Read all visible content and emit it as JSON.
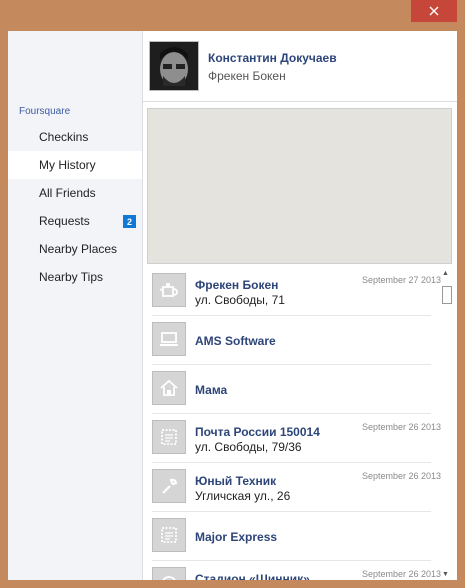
{
  "window": {
    "close_icon": "close-icon"
  },
  "sidebar": {
    "title": "Foursquare",
    "items": [
      {
        "label": "Checkins",
        "selected": false
      },
      {
        "label": "My History",
        "selected": true
      },
      {
        "label": "All Friends",
        "selected": false
      },
      {
        "label": "Requests",
        "selected": false,
        "badge": "2"
      },
      {
        "label": "Nearby Places",
        "selected": false
      },
      {
        "label": "Nearby Tips",
        "selected": false
      }
    ]
  },
  "profile": {
    "name": "Константин Докучаев",
    "location": "Фрекен Бокен"
  },
  "history": [
    {
      "icon": "teapot-icon",
      "name": "Фрекен Бокен",
      "address": "ул. Свободы, 71",
      "date": "September 27 2013"
    },
    {
      "icon": "laptop-icon",
      "name": "AMS Software",
      "address": "",
      "date": ""
    },
    {
      "icon": "home-icon",
      "name": "Мама",
      "address": "",
      "date": ""
    },
    {
      "icon": "stamp-icon",
      "name": "Почта России 150014",
      "address": "ул. Свободы, 79/36",
      "date": "September 26 2013"
    },
    {
      "icon": "wrench-icon",
      "name": "Юный Техник",
      "address": "Угличская ул., 26",
      "date": "September 26 2013"
    },
    {
      "icon": "stamp-icon",
      "name": "Major Express",
      "address": "",
      "date": ""
    },
    {
      "icon": "stadium-icon",
      "name": "Стадион «Шинник»",
      "address": "",
      "date": "September 26 2013"
    }
  ],
  "colors": {
    "frame": "#c48a5e",
    "close": "#c7463a",
    "accent": "#1079d6",
    "link": "#2d4579",
    "map": "#e5e3de"
  }
}
